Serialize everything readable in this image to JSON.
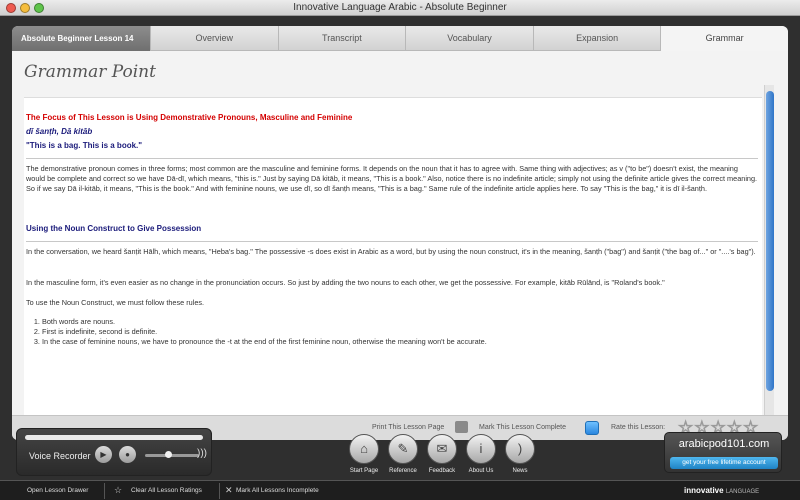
{
  "window": {
    "title": "Innovative Language Arabic - Absolute Beginner"
  },
  "tabs": {
    "lesson": "Absolute Beginner Lesson 14",
    "items": [
      "Overview",
      "Transcript",
      "Vocabulary",
      "Expansion",
      "Grammar"
    ],
    "active": "Grammar"
  },
  "content": {
    "title": "Grammar Point",
    "focus_heading": "The Focus of This Lesson is Using Demonstrative Pronouns, Masculine and Feminine",
    "transliteration": "dī šanṭh, Dā kitāb",
    "quote": "\"This is a bag. This is a book.\"",
    "para1": "The demonstrative pronoun comes in three forms; most common are the masculine and feminine forms. It depends on the noun that it has to agree with. Same thing with adjectives; as v (\"to be\") doesn't exist, the meaning would be complete and correct so we have Dā-dī, which means, \"this is.\" Just by saying Dā kitāb, it means, \"This is a book.\" Also, notice there is no indefinite article; simply not using the definite article gives the correct meaning. So if we say Dā il-kitāb, it means, \"This is the book.\" And with feminine nouns, we use dī, so dī šanṭh means, \"This is a bag.\" Same rule of the indefinite article applies here. To say \"This is the bag,\" it is dī il-šanṭh.",
    "section2_heading": "Using the Noun Construct to Give Possession",
    "para2": "In the conversation, we heard šanṭit Hālh, which means, \"Heba's bag.\" The possessive -s does exist in Arabic as a word, but by using the noun construct, it's in the meaning, šanṭh (\"bag\") and šanṭit (\"the bag of...\" or \"....'s bag\").",
    "para3": "In the masculine form, it's even easier as no change in the pronunciation occurs. So just by adding the two nouns to each other, we get the possessive. For example, kitāb Rūlānd, is \"Roland's book.\"",
    "para4": "To use the Noun Construct, we must follow these rules.",
    "rules": [
      "Both words are nouns.",
      "First is indefinite, second is definite.",
      "In the case of feminine nouns, we have to pronounce the -t at the end of the first feminine noun, otherwise the meaning won't be accurate."
    ]
  },
  "actions": {
    "print": "Print This Lesson Page",
    "mark_complete": "Mark This Lesson Complete",
    "rate": "Rate this Lesson:",
    "rating": 0
  },
  "recorder": {
    "label": "Voice Recorder",
    "volume_level": 0.45
  },
  "nav": [
    {
      "label": "Start Page",
      "icon": "home-icon"
    },
    {
      "label": "Reference",
      "icon": "reference-icon"
    },
    {
      "label": "Feedback",
      "icon": "feedback-icon"
    },
    {
      "label": "About Us",
      "icon": "info-icon"
    },
    {
      "label": "News",
      "icon": "rss-icon"
    }
  ],
  "brand": {
    "site": "arabicpod101.com",
    "cta": "get your free lifetime account"
  },
  "footer": {
    "open_drawer": "Open Lesson Drawer",
    "clear_ratings": "Clear All Lesson Ratings",
    "mark_incomplete": "Mark All Lessons Incomplete",
    "logo": "innovative",
    "logo_sub": "LANGUAGE"
  },
  "colors": {
    "accent_blue": "#2f75c8",
    "heading_red": "#d40000",
    "heading_blue": "#1a1a7a"
  }
}
